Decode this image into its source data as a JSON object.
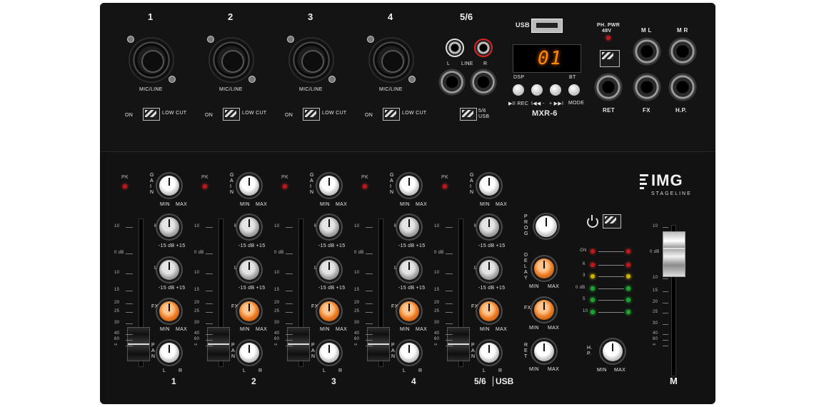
{
  "top": {
    "ch1": {
      "number": "1",
      "label": "MIC/LINE",
      "switch_on": "ON",
      "low_cut": "LOW CUT"
    },
    "ch2": {
      "number": "2",
      "label": "MIC/LINE",
      "switch_on": "ON",
      "low_cut": "LOW CUT"
    },
    "ch3": {
      "number": "3",
      "label": "MIC/LINE",
      "switch_on": "ON",
      "low_cut": "LOW CUT"
    },
    "ch4": {
      "number": "4",
      "label": "MIC/LINE",
      "switch_on": "ON",
      "low_cut": "LOW CUT"
    },
    "ch56": {
      "number": "5/6",
      "l": "L",
      "line": "LINE",
      "r": "R",
      "switch_a": "5/6",
      "switch_b": "USB"
    },
    "media": {
      "usb": "USB",
      "display": "01",
      "dsp": "DSP",
      "bt": "BT",
      "playrec": "▶II REC",
      "prev": "I◀◀ -",
      "next": "+ ▶▶I",
      "mode": "MODE",
      "model": "MXR-6"
    },
    "outputs": {
      "phpwr": "PH. PWR",
      "phpwr2": "48V",
      "ml": "M L",
      "mr": "M R",
      "ret": "RET",
      "fx": "FX",
      "hp": "H.P."
    }
  },
  "channel_labels": {
    "pk": "PK",
    "gain": "GAIN",
    "min": "MIN",
    "max": "MAX",
    "h": "H",
    "l": "L",
    "eq_scale": "-15 dB +15",
    "fx": "FX",
    "pan": "PAN",
    "pan_l": "L",
    "pan_r": "R"
  },
  "fader_scale": [
    "10",
    "0 dB",
    "10",
    "15",
    "20",
    "25",
    "30",
    "40",
    "60",
    "∞"
  ],
  "bottom_numbers": [
    "1",
    "2",
    "3",
    "4",
    "5/6",
    "USB"
  ],
  "effects": {
    "prog": "PROG",
    "delay": "DELAY",
    "fx": "FX",
    "ret": "RET",
    "min": "MIN",
    "max": "MAX"
  },
  "master": {
    "meter": [
      "ON",
      "6",
      "3",
      "0 dB",
      "5",
      "10"
    ],
    "hp": "H.P.",
    "min": "MIN",
    "max": "MAX",
    "label": "M",
    "scale": [
      "10",
      "0 dB",
      "10",
      "15",
      "20",
      "25",
      "30",
      "40",
      "60",
      "∞"
    ]
  },
  "brand": {
    "logo": "IMG",
    "sub": "STAGELINE"
  }
}
